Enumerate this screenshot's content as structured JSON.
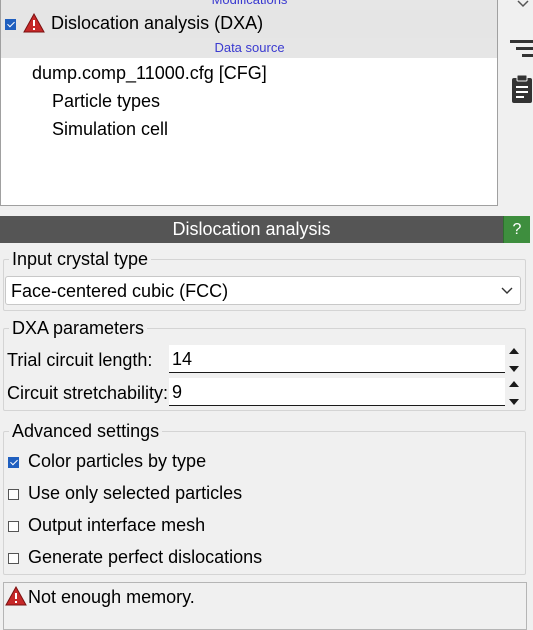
{
  "pipeline": {
    "modifications_header": "Modifications",
    "dxa_item": {
      "label": "Dislocation analysis (DXA)",
      "checked": true,
      "status_icon": "warning-icon"
    },
    "data_source_header": "Data source",
    "source_file": "dump.comp_11000.cfg [CFG]",
    "children": [
      "Particle types",
      "Simulation cell"
    ]
  },
  "toolbar": {
    "icons": [
      "chevron-down-icon",
      "reorder-lines-icon",
      "clipboard-icon"
    ]
  },
  "panel": {
    "title": "Dislocation analysis",
    "help_label": "?",
    "input_crystal": {
      "group_title": "Input crystal type",
      "selected": "Face-centered cubic (FCC)"
    },
    "dxa_params": {
      "group_title": "DXA parameters",
      "trial_label": "Trial circuit length:",
      "trial_value": "14",
      "stretch_label": "Circuit stretchability:",
      "stretch_value": "9"
    },
    "advanced": {
      "group_title": "Advanced settings",
      "options": [
        {
          "label": "Color particles by type",
          "checked": true
        },
        {
          "label": "Use only selected particles",
          "checked": false
        },
        {
          "label": "Output interface mesh",
          "checked": false
        },
        {
          "label": "Generate perfect dislocations",
          "checked": false
        }
      ]
    },
    "status_message": "Not enough memory."
  },
  "colors": {
    "accent": "#1f5fbf",
    "warning": "#c62828",
    "help_green": "#3e8e3e",
    "header_blue": "#3a3ad0"
  }
}
